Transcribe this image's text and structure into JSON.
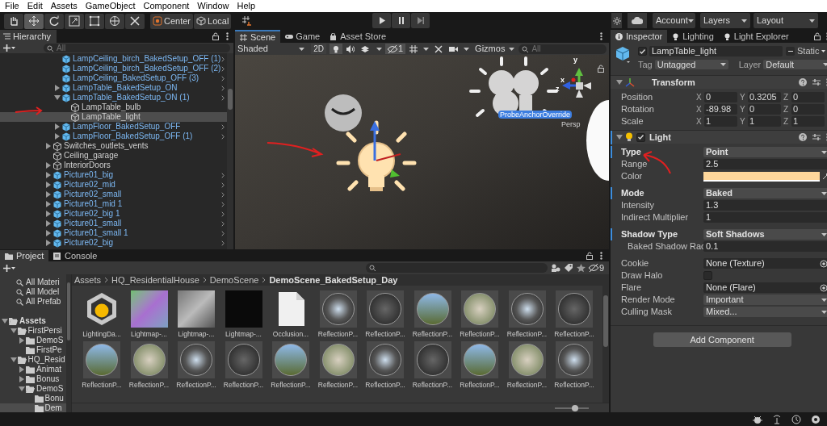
{
  "menu": [
    "File",
    "Edit",
    "Assets",
    "GameObject",
    "Component",
    "Window",
    "Help"
  ],
  "toolbar": {
    "tools": [
      {
        "kind": "hand",
        "selected": false
      },
      {
        "kind": "move",
        "selected": true
      },
      {
        "kind": "rotate",
        "selected": false
      },
      {
        "kind": "scale",
        "selected": false
      },
      {
        "kind": "rect",
        "selected": false
      },
      {
        "kind": "transform",
        "selected": false
      },
      {
        "kind": "custom",
        "selected": false
      }
    ],
    "pivot": "Center",
    "space": "Local",
    "account": "Account",
    "layers": "Layers",
    "layout": "Layout"
  },
  "hierarchy": {
    "title": "Hierarchy",
    "search_placeholder": "All",
    "scrolled_group": [
      {
        "label": "LampCeiling_birch_BakedSetup_OFF (1)",
        "kind": "prefab",
        "expandable": false,
        "selected": false
      },
      {
        "label": "LampCeiling_birch_BakedSetup_OFF (2)",
        "kind": "prefab",
        "expandable": false,
        "selected": false
      },
      {
        "label": "LampCeiling_BakedSetup_OFF (3)",
        "kind": "prefab",
        "expandable": false,
        "selected": false
      },
      {
        "label": "LampTable_BakedSetup_ON",
        "kind": "prefab",
        "expandable": true,
        "expanded": false,
        "selected": false
      },
      {
        "label": "LampTable_BakedSetup_ON (1)",
        "kind": "prefab",
        "expandable": true,
        "expanded": true,
        "selected": false,
        "children": [
          {
            "label": "LampTable_bulb",
            "kind": "object",
            "expandable": false,
            "selected": false
          },
          {
            "label": "LampTable_light",
            "kind": "object",
            "expandable": false,
            "selected": true
          }
        ]
      },
      {
        "label": "LampFloor_BakedSetup_OFF",
        "kind": "prefab",
        "expandable": true,
        "expanded": false,
        "selected": false
      },
      {
        "label": "LampFloor_BakedSetup_OFF (1)",
        "kind": "prefab",
        "expandable": true,
        "expanded": false,
        "selected": false
      }
    ],
    "items": [
      {
        "label": "Switches_outlets_vents",
        "kind": "object",
        "expandable": true,
        "expanded": false,
        "selected": false
      },
      {
        "label": "Ceiling_garage",
        "kind": "object",
        "expandable": false,
        "selected": false
      },
      {
        "label": "InteriorDoors",
        "kind": "object",
        "expandable": true,
        "expanded": false,
        "selected": false
      },
      {
        "label": "Picture01_big",
        "kind": "prefab",
        "expandable": true,
        "expanded": false,
        "selected": false
      },
      {
        "label": "Picture02_mid",
        "kind": "prefab",
        "expandable": true,
        "expanded": false,
        "selected": false
      },
      {
        "label": "Picture02_small",
        "kind": "prefab",
        "expandable": true,
        "expanded": false,
        "selected": false
      },
      {
        "label": "Picture01_mid 1",
        "kind": "prefab",
        "expandable": true,
        "expanded": false,
        "selected": false
      },
      {
        "label": "Picture02_big 1",
        "kind": "prefab",
        "expandable": true,
        "expanded": false,
        "selected": false
      },
      {
        "label": "Picture01_small",
        "kind": "prefab",
        "expandable": true,
        "expanded": false,
        "selected": false
      },
      {
        "label": "Picture01_small 1",
        "kind": "prefab",
        "expandable": true,
        "expanded": false,
        "selected": false
      },
      {
        "label": "Picture02_big",
        "kind": "prefab",
        "expandable": true,
        "expanded": false,
        "selected": false
      }
    ]
  },
  "scene": {
    "tabs": [
      {
        "label": "Scene",
        "selected": true
      },
      {
        "label": "Game",
        "selected": false
      },
      {
        "label": "Asset Store",
        "selected": false
      }
    ],
    "shading": "Shaded",
    "mode_2d": "2D",
    "hidden_count": "1",
    "gizmos": "Gizmos",
    "search_placeholder": "All",
    "probe_label": "ProbeAnchorOverride",
    "projection": "Persp",
    "axes": [
      "x",
      "y",
      "z"
    ]
  },
  "inspector": {
    "tabs": [
      {
        "label": "Inspector",
        "selected": true
      },
      {
        "label": "Lighting",
        "selected": false
      },
      {
        "label": "Light Explorer",
        "selected": false
      }
    ],
    "object": {
      "active": true,
      "name": "LampTable_light",
      "static_mixed": true,
      "static_label": "Static",
      "tag_label": "Tag",
      "tag": "Untagged",
      "layer_label": "Layer",
      "layer": "Default"
    },
    "components": [
      {
        "kind": "transform",
        "title": "Transform",
        "rows": [
          {
            "label": "Position",
            "values": [
              {
                "axis": "X",
                "value": "0"
              },
              {
                "axis": "Y",
                "value": "0.3205"
              },
              {
                "axis": "Z",
                "value": "0"
              }
            ]
          },
          {
            "label": "Rotation",
            "values": [
              {
                "axis": "X",
                "value": "-89.98"
              },
              {
                "axis": "Y",
                "value": "0"
              },
              {
                "axis": "Z",
                "value": "0"
              }
            ]
          },
          {
            "label": "Scale",
            "values": [
              {
                "axis": "X",
                "value": "1"
              },
              {
                "axis": "Y",
                "value": "1"
              },
              {
                "axis": "Z",
                "value": "1"
              }
            ]
          }
        ]
      },
      {
        "kind": "light",
        "title": "Light",
        "enabled": true,
        "sections": [
          [
            {
              "label": "Type",
              "kind": "dropdown",
              "value": "Point",
              "overridden": true
            },
            {
              "label": "Range",
              "kind": "text",
              "value": "2.5",
              "overridden": false
            },
            {
              "label": "Color",
              "kind": "color",
              "color": "#ffd79b",
              "overridden": false
            }
          ],
          [
            {
              "label": "Mode",
              "kind": "dropdown",
              "value": "Baked",
              "overridden": true
            },
            {
              "label": "Intensity",
              "kind": "text",
              "value": "1.3",
              "overridden": false
            },
            {
              "label": "Indirect Multiplier",
              "kind": "text",
              "value": "1",
              "overridden": false
            }
          ],
          [
            {
              "label": "Shadow Type",
              "kind": "dropdown",
              "value": "Soft Shadows",
              "overridden": true,
              "children": [
                {
                  "label": "Baked Shadow Rac",
                  "kind": "text",
                  "value": "0.1",
                  "overridden": false
                }
              ]
            }
          ],
          [
            {
              "label": "Cookie",
              "kind": "object",
              "value": "None (Texture)",
              "overridden": false
            },
            {
              "label": "Draw Halo",
              "kind": "checkbox",
              "checked": false,
              "overridden": false
            },
            {
              "label": "Flare",
              "kind": "object",
              "value": "None (Flare)",
              "overridden": false
            },
            {
              "label": "Render Mode",
              "kind": "dropdown",
              "value": "Important",
              "overridden": false
            },
            {
              "label": "Culling Mask",
              "kind": "dropdown",
              "value": "Mixed...",
              "overridden": false
            }
          ]
        ]
      }
    ],
    "add_component": "Add Component"
  },
  "project": {
    "tabs": [
      {
        "label": "Project",
        "selected": true
      },
      {
        "label": "Console",
        "selected": false
      }
    ],
    "hidden_count": "9",
    "favorites": [
      "All Materi",
      "All Model",
      "All Prefab"
    ],
    "folders": [
      {
        "label": "Assets",
        "expandable": true,
        "expanded": true,
        "selected": false,
        "children": [
          {
            "label": "FirstPersi",
            "expandable": true,
            "expanded": true,
            "selected": false,
            "children": [
              {
                "label": "DemoS",
                "expandable": true,
                "expanded": false,
                "selected": false
              },
              {
                "label": "FirstPe",
                "expandable": false,
                "selected": false
              }
            ]
          },
          {
            "label": "HQ_Resid",
            "expandable": true,
            "expanded": true,
            "selected": false,
            "children": [
              {
                "label": "Animat",
                "expandable": true,
                "expanded": false,
                "selected": false
              },
              {
                "label": "Bonus",
                "expandable": true,
                "expanded": false,
                "selected": false
              },
              {
                "label": "DemoS",
                "expandable": true,
                "expanded": true,
                "selected": false,
                "children": [
                  {
                    "label": "Bonu",
                    "expandable": false,
                    "selected": false
                  },
                  {
                    "label": "Dem",
                    "expandable": false,
                    "selected": true
                  }
                ]
              }
            ]
          }
        ]
      }
    ],
    "breadcrumb": [
      "Assets",
      "HQ_ResidentialHouse",
      "DemoScene",
      "DemoScene_BakedSetup_Day"
    ],
    "assets": [
      {
        "label": "LightingDa...",
        "kind": "lighting_data"
      },
      {
        "label": "Lightmap-...",
        "kind": "lightmap"
      },
      {
        "label": "Lightmap-...",
        "kind": "lightmap"
      },
      {
        "label": "Lightmap-...",
        "kind": "lightmap"
      },
      {
        "label": "Occlusion...",
        "kind": "file"
      },
      {
        "label": "ReflectionP...",
        "kind": "reflection_probe"
      },
      {
        "label": "ReflectionP...",
        "kind": "reflection_probe"
      },
      {
        "label": "ReflectionP...",
        "kind": "reflection_probe"
      },
      {
        "label": "ReflectionP...",
        "kind": "reflection_probe"
      },
      {
        "label": "ReflectionP...",
        "kind": "reflection_probe"
      },
      {
        "label": "ReflectionP...",
        "kind": "reflection_probe"
      },
      {
        "label": "ReflectionP...",
        "kind": "reflection_probe"
      },
      {
        "label": "ReflectionP...",
        "kind": "reflection_probe"
      },
      {
        "label": "ReflectionP...",
        "kind": "reflection_probe"
      },
      {
        "label": "ReflectionP...",
        "kind": "reflection_probe"
      },
      {
        "label": "ReflectionP...",
        "kind": "reflection_probe"
      },
      {
        "label": "ReflectionP...",
        "kind": "reflection_probe"
      },
      {
        "label": "ReflectionP...",
        "kind": "reflection_probe"
      },
      {
        "label": "ReflectionP...",
        "kind": "reflection_probe"
      },
      {
        "label": "ReflectionP...",
        "kind": "reflection_probe"
      },
      {
        "label": "ReflectionP...",
        "kind": "reflection_probe"
      },
      {
        "label": "ReflectionP...",
        "kind": "reflection_probe"
      }
    ],
    "zoom": {
      "level": 0.6
    }
  }
}
